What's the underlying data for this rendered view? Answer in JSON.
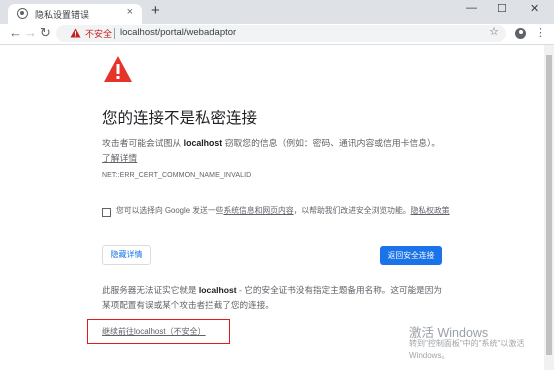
{
  "browser": {
    "tab_title": "隐私设置错误",
    "tab_close": "×",
    "new_tab": "+",
    "window_controls": {
      "minimize": "—",
      "maximize": "☐",
      "close": "✕"
    }
  },
  "toolbar": {
    "back": "←",
    "forward": "→",
    "reload": "↻",
    "security_label": "不安全",
    "url": "localhost/portal/webadaptor",
    "star": "☆",
    "menu": "⋮"
  },
  "page": {
    "title": "您的连接不是私密连接",
    "desc_prefix": "攻击者可能会试图从 ",
    "desc_host": "localhost",
    "desc_middle": " 窃取您的信息（例如：密码、通讯内容或信用卡信息）。",
    "desc_link": "了解详情",
    "error_code": "NET::ERR_CERT_COMMON_NAME_INVALID",
    "checkbox_text_prefix": "您可以选择向 Google 发送一些",
    "checkbox_link1": "系统信息和网页内容",
    "checkbox_text_middle": "，以帮助我们改进安全浏览功能。",
    "checkbox_link2": "隐私权政策",
    "hide_details_button": "隐藏详情",
    "back_to_safety_button": "返回安全连接",
    "details_prefix": "此服务器无法证实它就是 ",
    "details_host": "localhost",
    "details_suffix": " - 它的安全证书没有指定主题备用名称。这可能是因为某项配置有误或某个攻击者拦截了您的连接。",
    "proceed_link": "继续前往localhost（不安全）"
  },
  "watermark": {
    "title": "激活 Windows",
    "subtitle": "转到\"控制面板\"中的\"系统\"以激活 Windows。"
  },
  "colors": {
    "warning_red": "#e5352b",
    "link_blue": "#1a73e8",
    "highlight_box": "#e0191f"
  }
}
